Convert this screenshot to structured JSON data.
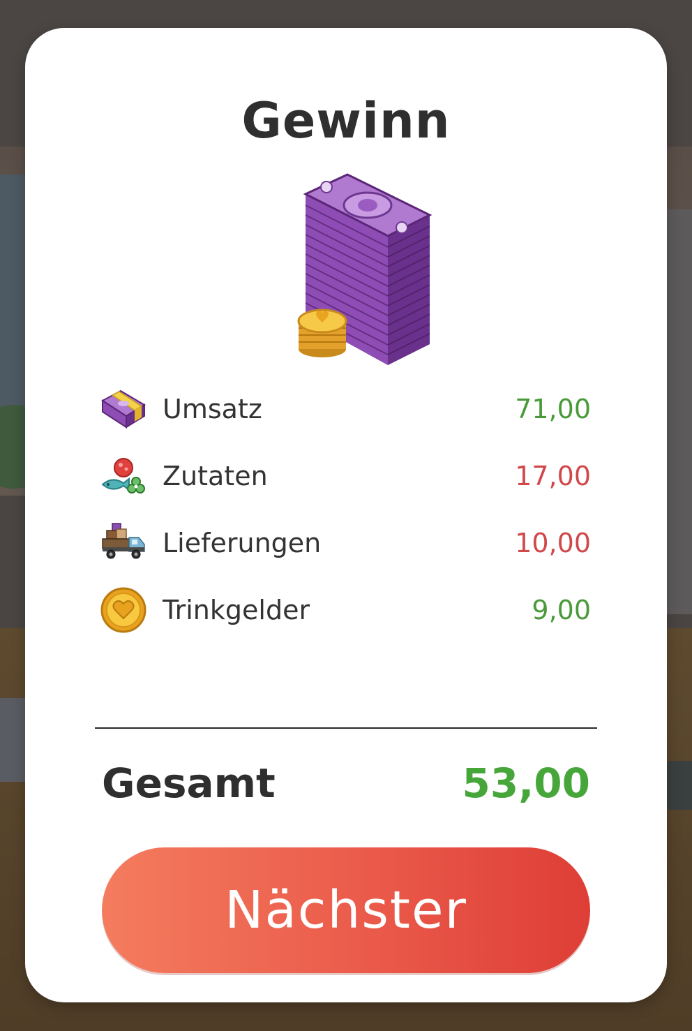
{
  "dialog": {
    "title": "Gewinn",
    "hero_icon": "money-stack-icon"
  },
  "breakdown": [
    {
      "icon": "cash-bundle-icon",
      "label": "Umsatz",
      "value": "71,00",
      "sign": "positive",
      "value_color": "#4a9a3a"
    },
    {
      "icon": "ingredients-icon",
      "label": "Zutaten",
      "value": "17,00",
      "sign": "negative",
      "value_color": "#d0484a"
    },
    {
      "icon": "delivery-truck-icon",
      "label": "Lieferungen",
      "value": "10,00",
      "sign": "negative",
      "value_color": "#d0484a"
    },
    {
      "icon": "heart-coin-icon",
      "label": "Trinkgelder",
      "value": "9,00",
      "sign": "positive",
      "value_color": "#4a9a3a"
    }
  ],
  "total": {
    "label": "Gesamt",
    "value": "53,00",
    "value_color": "#46a63a"
  },
  "next_button": {
    "label": "Nächster",
    "color_start": "#f47c5e",
    "color_end": "#de3e36"
  }
}
